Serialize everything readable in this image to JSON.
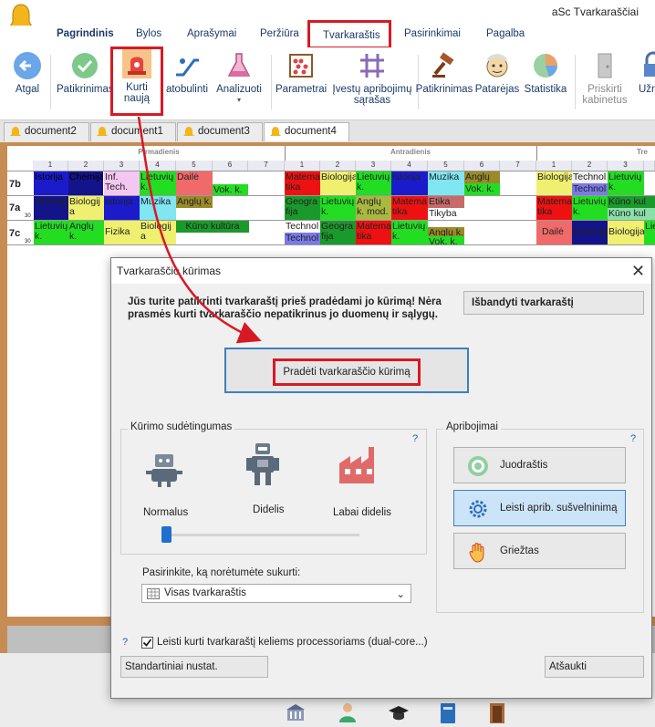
{
  "app": {
    "title": "aSc Tvarkaraščiai"
  },
  "menu": {
    "items": [
      "Pagrindinis",
      "Bylos",
      "Aprašymai",
      "Peržiūra",
      "Tvarkaraštis",
      "Pasirinkimai",
      "Pagalba"
    ]
  },
  "ribbon": {
    "back": "Atgal",
    "check": "Patikrinimas",
    "create_new_l1": "Kurti",
    "create_new_l2": "naują",
    "improve": "atobulinti",
    "analyze": "Analizuoti",
    "params": "Parametrai",
    "constraints_l1": "Įvestų apribojimų",
    "constraints_l2": "sąrašas",
    "check2": "Patikrinimas",
    "advisor": "Patarėjas",
    "stats": "Statistika",
    "assign_rooms_l1": "Priskirti",
    "assign_rooms_l2": "kabinetus",
    "lock": "Užrak"
  },
  "doc_tabs": [
    "document2",
    "document1",
    "document3",
    "document4"
  ],
  "grid": {
    "days": [
      "Pirmadienis",
      "Antradienis",
      "Tre"
    ],
    "periods": [
      "1",
      "2",
      "3",
      "4",
      "5",
      "6",
      "7"
    ],
    "rows": [
      {
        "label": "7b",
        "sub": ""
      },
      {
        "label": "7a",
        "sub": "30"
      },
      {
        "label": "7c",
        "sub": "30"
      }
    ],
    "lessons": [
      "Istorija",
      "Chemija",
      "Inf. Tech.",
      "Lietuvių k.",
      "Dailė",
      "Vok. k.",
      "Matema tika",
      "Biologija",
      "Lietuvių k.",
      "Istorija",
      "Muzika",
      "Anglų k.",
      "Vok. k.",
      "Biologija",
      "Technol",
      "Technol",
      "Lietuvių k.",
      "Chemija",
      "Biologij a",
      "Istorija",
      "Muzika",
      "Anglų k.",
      "Geogra fija",
      "Lietuvių k.",
      "Anglų k. mod.",
      "Matema tika",
      "Etika",
      "Tikyba",
      "Matema tika",
      "Lietuvių k.",
      "Kūno kul",
      "Kūno kul",
      "Lietuvių k.",
      "Anglų k.",
      "Fizika",
      "Biologij a",
      "Kūno kultūra",
      "Technol",
      "Technol",
      "Geogra fija",
      "Matema tika",
      "Lietuvių k.",
      "Anglų k.",
      "Vok. k.",
      "Dailė",
      "Chemija",
      "Biologija",
      "Lietuvių"
    ]
  },
  "dialog": {
    "title": "Tvarkaraščio kūrimas",
    "warning": "Jūs turite patikrinti tvarkaraštį prieš pradėdami jo kūrimą! Nėra prasmės kurti tvarkaraščio nepatikrinus jo duomenų ir sąlygų.",
    "test_button": "Išbandyti tvarkaraštį",
    "start_button": "Pradėti tvarkaraščio kūrimą",
    "complexity_group": "Kūrimo sudėtingumas",
    "complexity_levels": [
      "Normalus",
      "Didelis",
      "Labai didelis"
    ],
    "complexity_value": 0,
    "limits_group": "Apribojimai",
    "limits": [
      "Juodraštis",
      "Leisti aprib. sušvelninimą",
      "Griežtas"
    ],
    "help": "?",
    "select_label": "Pasirinkite, ką norėtumėte sukurti:",
    "select_value": "Visas tvarkaraštis",
    "dual_core_label": "Leisti kurti tvarkaraštį keliems processoriams (dual-core...)",
    "dual_core_checked": true,
    "defaults_button": "Standartiniai nustat.",
    "cancel_button": "Atšaukti"
  },
  "colors": {
    "highlight": "#d61a24",
    "accent": "#3c7fc1",
    "slider": "#1e6fd0"
  }
}
